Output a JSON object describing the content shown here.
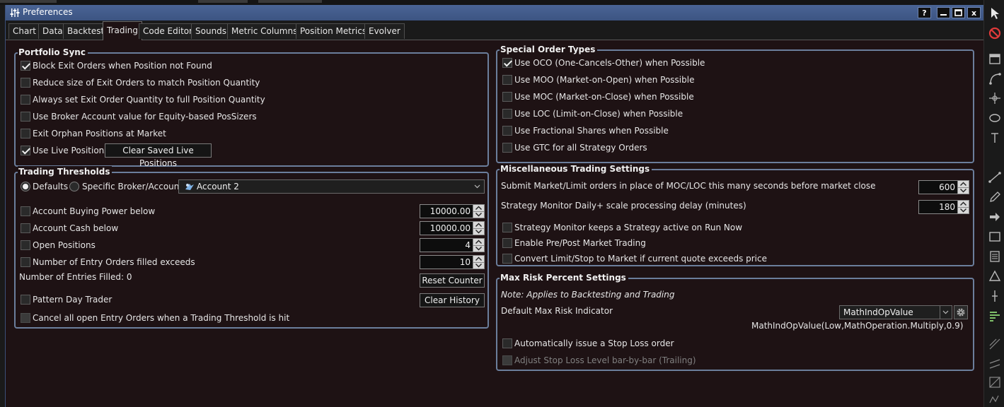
{
  "window": {
    "title": "Preferences",
    "help": "?",
    "minimize": "minimize",
    "maximize": "maximize",
    "close": "x"
  },
  "tabs": [
    "Chart",
    "Data",
    "Backtest",
    "Trading",
    "Code Editor",
    "Sounds",
    "Metric Columns",
    "Position Metrics",
    "Evolver"
  ],
  "active_tab": "Trading",
  "portfolio_sync": {
    "title": "Portfolio Sync",
    "items": [
      {
        "label": "Block Exit Orders when Position not Found",
        "checked": true
      },
      {
        "label": "Reduce size of Exit Orders to match Position Quantity",
        "checked": false
      },
      {
        "label": "Always set Exit Order Quantity to full Position Quantity",
        "checked": false
      },
      {
        "label": "Use Broker Account value for Equity-based PosSizers",
        "checked": false
      },
      {
        "label": "Exit Orphan Positions at Market",
        "checked": false
      },
      {
        "label": "Use Live Positions",
        "checked": true
      }
    ],
    "clear_button": "Clear Saved Live Positions"
  },
  "trading_thresholds": {
    "title": "Trading Thresholds",
    "radio_defaults": "Defaults",
    "radio_specific": "Specific Broker/Account",
    "account": "Account 2",
    "items": [
      {
        "label": "Account Buying Power below",
        "value": "10000.00",
        "checked": false
      },
      {
        "label": "Account Cash below",
        "value": "10000.00",
        "checked": false
      },
      {
        "label": "Open Positions",
        "value": "4",
        "checked": false
      },
      {
        "label": "Number of Entry Orders filled exceeds",
        "value": "10",
        "checked": false
      }
    ],
    "entries_filled": "Number of Entries Filled: 0",
    "reset_button": "Reset Counter",
    "pattern_day_trader": "Pattern Day Trader",
    "clear_history_button": "Clear History",
    "cancel_all": "Cancel all open Entry Orders when a Trading Threshold is hit"
  },
  "special_order_types": {
    "title": "Special Order Types",
    "items": [
      {
        "label": "Use OCO (One-Cancels-Other) when Possible",
        "checked": true
      },
      {
        "label": "Use MOO (Market-on-Open) when Possible",
        "checked": false
      },
      {
        "label": "Use MOC (Market-on-Close) when Possible",
        "checked": false
      },
      {
        "label": "Use LOC (Limit-on-Close) when Possible",
        "checked": false
      },
      {
        "label": "Use Fractional Shares when Possible",
        "checked": false
      },
      {
        "label": "Use GTC for all Strategy Orders",
        "checked": false
      }
    ]
  },
  "misc": {
    "title": "Miscellaneous Trading Settings",
    "submit_label": "Submit Market/Limit orders in place of MOC/LOC this many seconds before market close",
    "submit_value": "600",
    "delay_label": "Strategy Monitor Daily+ scale processing delay (minutes)",
    "delay_value": "180",
    "items": [
      {
        "label": "Strategy Monitor keeps a Strategy active on Run Now",
        "checked": false
      },
      {
        "label": "Enable Pre/Post Market Trading",
        "checked": false
      },
      {
        "label": "Convert Limit/Stop to Market if current quote exceeds price",
        "checked": false
      }
    ]
  },
  "max_risk": {
    "title": "Max Risk Percent Settings",
    "note": "Note: Applies to Backtesting and Trading",
    "indicator_label": "Default Max Risk Indicator",
    "indicator_value": "MathIndOpValue",
    "indicator_expr": "MathIndOpValue(Low,MathOperation.Multiply,0.9)",
    "stop_loss": "Automatically issue a Stop Loss order",
    "trailing": "Adjust Stop Loss Level bar-by-bar (Trailing)"
  }
}
